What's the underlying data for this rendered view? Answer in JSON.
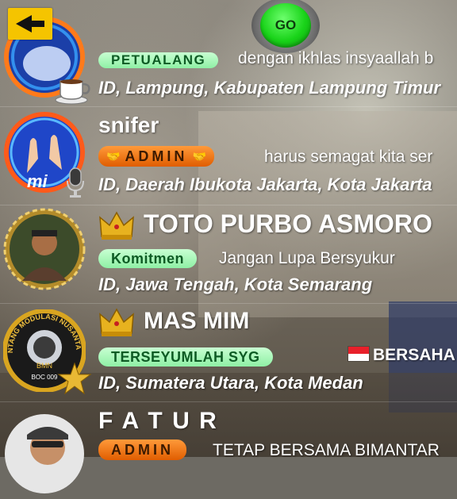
{
  "header": {
    "back_icon": "arrow-left-icon",
    "go_label": "GO"
  },
  "rows": [
    {
      "badge": "PETUALANG",
      "status": "dengan ikhlas insyaallah b",
      "location": "ID, Lampung, Kabupaten Lampung Timur",
      "extra_icon": "coffee-cup-icon"
    },
    {
      "name": "snifer",
      "badge": "ADMIN",
      "status": "harus semagat kita ser",
      "location": "ID, Daerah Ibukota Jakarta, Kota Jakarta",
      "extra_icon": "microphone-icon"
    },
    {
      "name": "TOTO PURBO ASMORO",
      "badge": "Komitmen",
      "status": "Jangan Lupa Bersyukur",
      "location": "ID, Jawa Tengah, Kota Semarang",
      "rank_icon": "crown-icon"
    },
    {
      "name": "MAS MIM",
      "badge": "TERSEYUMLAH SYG",
      "status": "BERSAHA",
      "location": "ID, Sumatera Utara, Kota Medan",
      "rank_icon": "crown-icon",
      "avatar_text": "BINTANG MODULASI NUSANTARA",
      "avatar_code": "BMN",
      "avatar_sub": "BOC 009"
    },
    {
      "name": "F A T U R",
      "badge": "ADMIN",
      "status": "TETAP BERSAMA BIMANTAR"
    }
  ],
  "colors": {
    "accent_yellow": "#f5c400",
    "go_green": "#19d319",
    "badge_green": "#8ff0a5",
    "badge_orange": "#e05d00",
    "flag_red": "#e8202a"
  }
}
